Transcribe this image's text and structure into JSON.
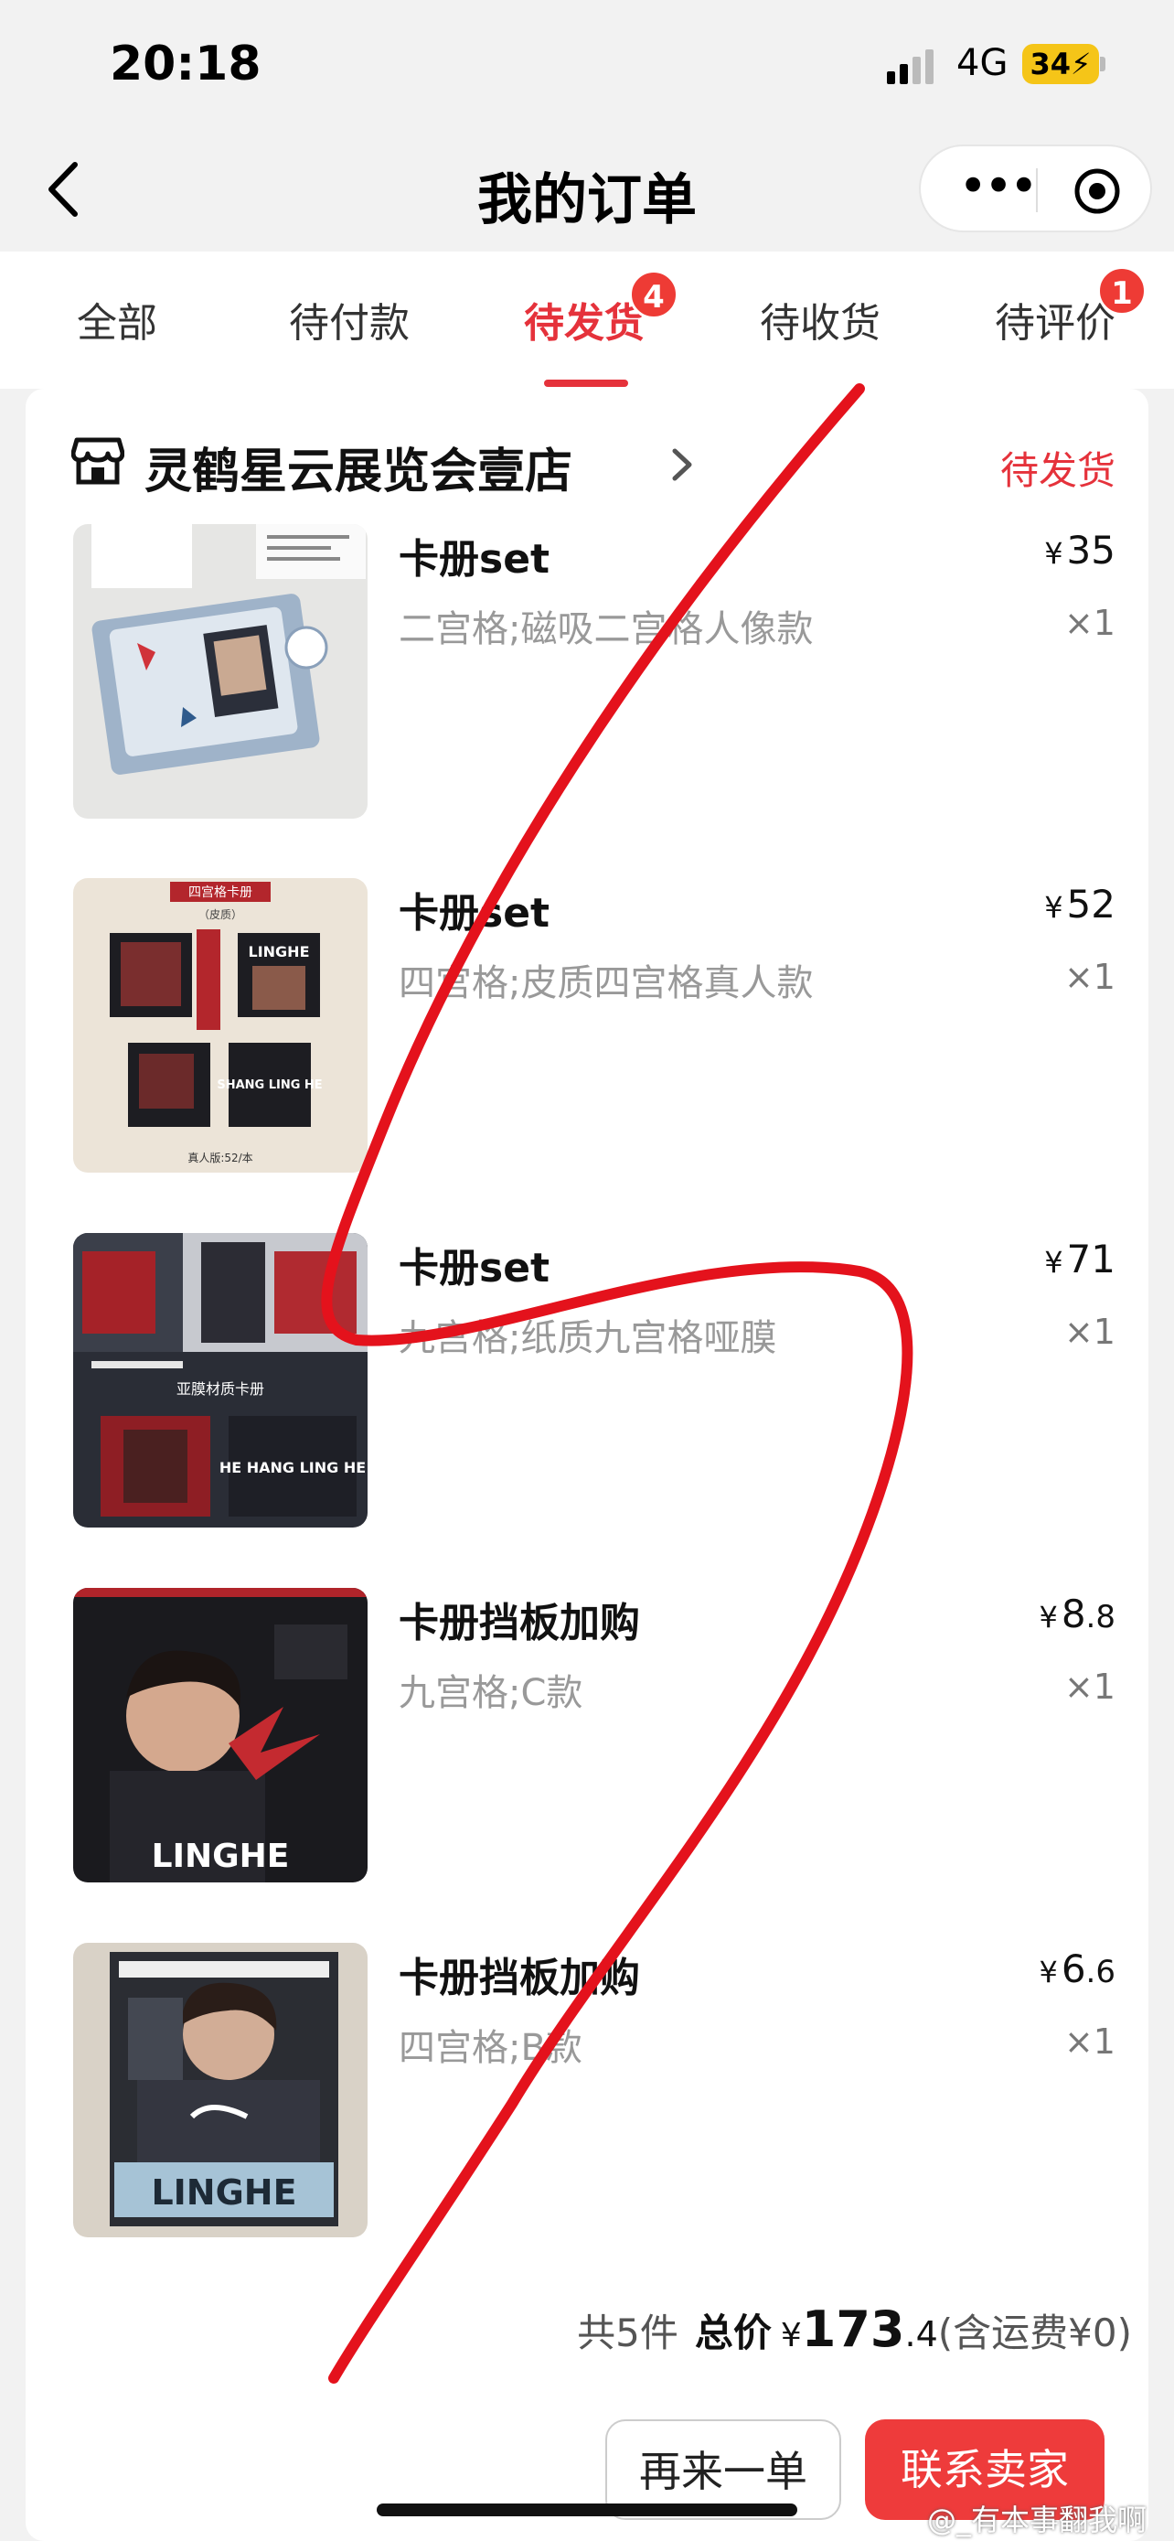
{
  "status_bar": {
    "time": "20:18",
    "network": "4G",
    "battery": "34"
  },
  "nav": {
    "title": "我的订单",
    "more_icon": "more-dots-icon",
    "target_icon": "target-icon"
  },
  "tabs": [
    {
      "label": "全部"
    },
    {
      "label": "待付款"
    },
    {
      "label": "待发货",
      "badge": "4",
      "active": true
    },
    {
      "label": "待收货"
    },
    {
      "label": "待评价",
      "badge": "1"
    }
  ],
  "shop": {
    "name": "灵鹤星云展览会壹店",
    "status": "待发货"
  },
  "items": [
    {
      "title": "卡册set",
      "spec": "二宫格;磁吸二宫格人像款",
      "price_int": "35",
      "price_dec": "",
      "qty": "×1"
    },
    {
      "title": "卡册set",
      "spec": "四宫格;皮质四宫格真人款",
      "price_int": "52",
      "price_dec": "",
      "qty": "×1"
    },
    {
      "title": "卡册set",
      "spec": "九宫格;纸质九宫格哑膜",
      "price_int": "71",
      "price_dec": "",
      "qty": "×1"
    },
    {
      "title": "卡册挡板加购",
      "spec": "九宫格;C款",
      "price_int": "8",
      "price_dec": ".8",
      "qty": "×1"
    },
    {
      "title": "卡册挡板加购",
      "spec": "四宫格;B款",
      "price_int": "6",
      "price_dec": ".6",
      "qty": "×1"
    }
  ],
  "currency": "¥",
  "thumb_text": {
    "t2_header": "四宫格卡册",
    "t2_sub": "（皮质）",
    "t2_logo": "LINGHE",
    "t2_card": "SHANG LING HE",
    "t2_footer": "真人版:52/本",
    "t3_label": "亚膜材质卡册",
    "t3_card": "HE HANG LING HE",
    "t4_logo": "LINGHE",
    "t5_logo": "LINGHE"
  },
  "summary": {
    "count": "共5件",
    "total_label": "总价",
    "total_int": "173",
    "total_dec": ".4",
    "shipping": "(含运费¥0)"
  },
  "buttons": {
    "again": "再来一单",
    "contact": "联系卖家"
  },
  "watermark": "@_有本事翻我啊",
  "colors": {
    "accent": "#e5323b",
    "badge": "#ee3b35",
    "scribble": "#e4121c"
  }
}
